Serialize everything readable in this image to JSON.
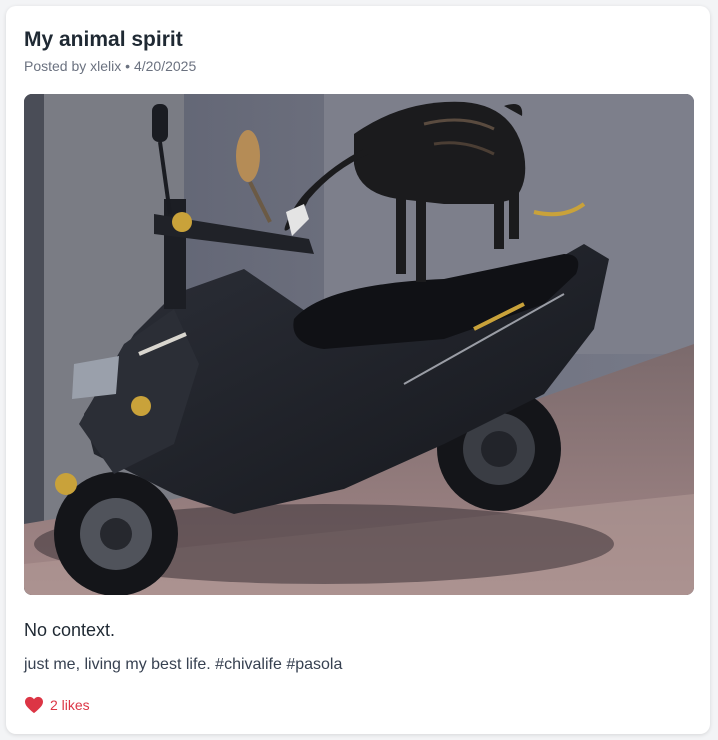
{
  "post": {
    "title": "My animal spirit",
    "author_prefix": "Posted by",
    "author": "xlelix",
    "separator": "•",
    "date": "4/20/2025",
    "image_icon": "photo-goat-on-scooter",
    "heading_text": "No context.",
    "body_text": "just me, living my best life. #chivalife #pasola",
    "likes_label": "2 likes",
    "like_icon": "heart-icon",
    "like_color": "#dc3545"
  }
}
